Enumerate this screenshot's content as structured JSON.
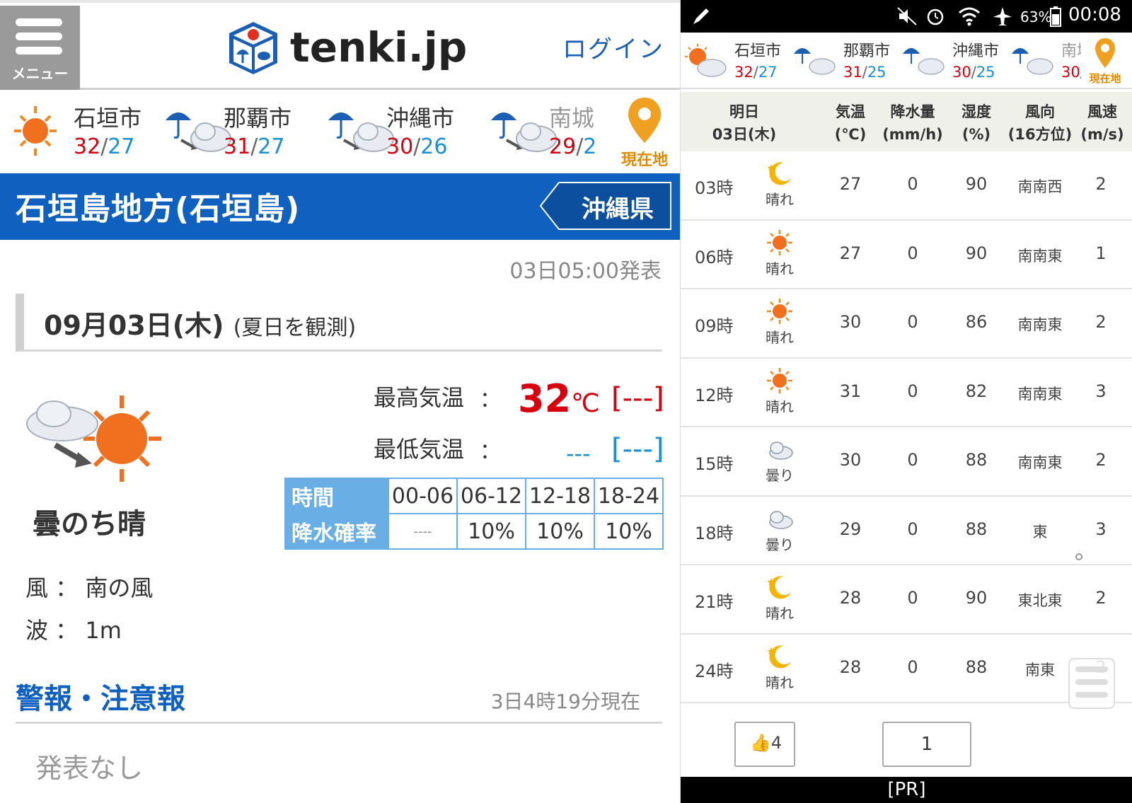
{
  "left": {
    "menu_label": "メニュー",
    "logo_text": "tenki.jp",
    "login_label": "ログイン",
    "cities": [
      {
        "name": "石垣市",
        "hi": "32",
        "lo": "27",
        "icon": "sunny-icon"
      },
      {
        "name": "那覇市",
        "hi": "31",
        "lo": "27",
        "icon": "rain-then-cloudy-icon"
      },
      {
        "name": "沖縄市",
        "hi": "30",
        "lo": "26",
        "icon": "rain-then-cloudy-icon"
      },
      {
        "name": "南城",
        "hi": "29",
        "lo": "2",
        "icon": "rain-then-cloudy-icon"
      }
    ],
    "slash": "/",
    "current_location_label": "現在地",
    "region_title": "石垣島地方(石垣島)",
    "prefecture_label": "沖縄県",
    "issued": "03日05:00発表",
    "date": "09月03日(木)",
    "date_note": "(夏日を観測)",
    "weather_label": "曇のち晴",
    "max_temp_label": "最高気温",
    "min_temp_label": "最低気温",
    "colon": "：",
    "max_temp_value": "32",
    "temp_unit": "℃",
    "max_temp_diff": "[---]",
    "min_temp_value": "---",
    "min_temp_diff": "[---]",
    "rain_table": {
      "header_top": "時間",
      "header_bottom": "降水確率",
      "periods": [
        "00-06",
        "06-12",
        "12-18",
        "18-24"
      ],
      "values": [
        "----",
        "10%",
        "10%",
        "10%"
      ]
    },
    "wind": "風 ： 南の風",
    "wave": "波 ： 1m",
    "alert_title": "警報・注意報",
    "alert_time": "3日4時19分現在",
    "alert_none": "発表なし"
  },
  "right": {
    "status": {
      "battery": "63%",
      "time": "00:08"
    },
    "cities": [
      {
        "name": "石垣市",
        "hi": "32",
        "lo": "27"
      },
      {
        "name": "那覇市",
        "hi": "31",
        "lo": "25"
      },
      {
        "name": "沖縄市",
        "hi": "30",
        "lo": "25"
      },
      {
        "name": "南城",
        "hi": "30",
        "lo": ""
      }
    ],
    "current_location_label": "現在地",
    "header": {
      "day_top": "明日",
      "day_bottom": "03日(木)",
      "temp_top": "気温",
      "temp_bottom": "(℃)",
      "prec_top": "降水量",
      "prec_bottom": "(mm/h)",
      "hum_top": "湿度",
      "hum_bottom": "(%)",
      "wdir_top": "風向",
      "wdir_bottom": "(16方位)",
      "wspd_top": "風速",
      "wspd_bottom": "(m/s)"
    },
    "rows": [
      {
        "time": "03時",
        "icon": "moon-icon",
        "weather": "晴れ",
        "temp": "27",
        "prec": "0",
        "hum": "90",
        "wdir": "南南西",
        "wspd": "2"
      },
      {
        "time": "06時",
        "icon": "sun-icon",
        "weather": "晴れ",
        "temp": "27",
        "prec": "0",
        "hum": "90",
        "wdir": "南南東",
        "wspd": "1"
      },
      {
        "time": "09時",
        "icon": "sun-icon",
        "weather": "晴れ",
        "temp": "30",
        "prec": "0",
        "hum": "86",
        "wdir": "南南東",
        "wspd": "2"
      },
      {
        "time": "12時",
        "icon": "sun-icon",
        "weather": "晴れ",
        "temp": "31",
        "prec": "0",
        "hum": "82",
        "wdir": "南南東",
        "wspd": "3"
      },
      {
        "time": "15時",
        "icon": "cloud-icon",
        "weather": "曇り",
        "temp": "30",
        "prec": "0",
        "hum": "88",
        "wdir": "南南東",
        "wspd": "2"
      },
      {
        "time": "18時",
        "icon": "cloud-icon",
        "weather": "曇り",
        "temp": "29",
        "prec": "0",
        "hum": "88",
        "wdir": "東",
        "wspd": "3"
      },
      {
        "time": "21時",
        "icon": "moon-icon",
        "weather": "晴れ",
        "temp": "28",
        "prec": "0",
        "hum": "90",
        "wdir": "東北東",
        "wspd": "2"
      },
      {
        "time": "24時",
        "icon": "moon-icon",
        "weather": "晴れ",
        "temp": "28",
        "prec": "0",
        "hum": "88",
        "wdir": "南東",
        "wspd": "2"
      }
    ],
    "like_count": "4",
    "comment_count": "1",
    "ad_label": "[PR]"
  },
  "colors": {
    "brand_blue": "#1060c0",
    "high_red": "#d7000f",
    "low_blue": "#1a8fd6",
    "pin_orange": "#e08a00"
  }
}
